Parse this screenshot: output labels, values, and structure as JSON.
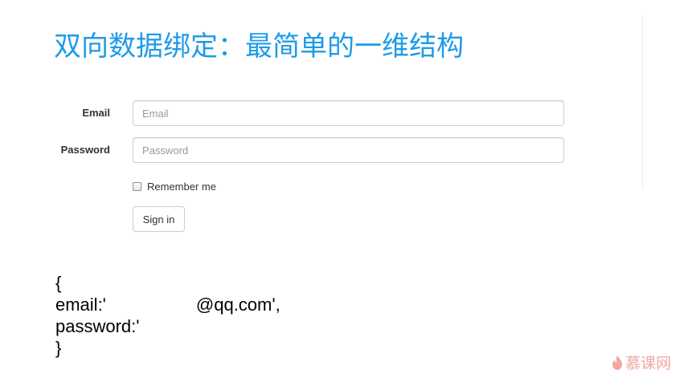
{
  "slide": {
    "title": "双向数据绑定：最简单的一维结构"
  },
  "form": {
    "email_label": "Email",
    "email_placeholder": "Email",
    "password_label": "Password",
    "password_placeholder": "Password",
    "remember_label": "Remember me",
    "submit_label": "Sign in"
  },
  "code": {
    "open_brace": "{",
    "email_key": "email:'",
    "email_value_visible": "@qq.com',",
    "password_key": "password:'",
    "close_brace": "}"
  },
  "watermark": {
    "text": "慕课网"
  },
  "colors": {
    "title": "#1e9be8",
    "watermark": "#f1a7a2"
  }
}
